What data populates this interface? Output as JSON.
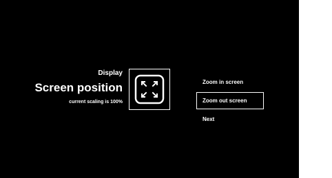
{
  "screen": {
    "section_label": "Display",
    "title": "Screen position",
    "subtitle": "current scaling is 100%",
    "icon": "fullscreen-icon"
  },
  "menu": {
    "items": [
      {
        "label": "Zoom in screen",
        "selected": false
      },
      {
        "label": "Zoom out screen",
        "selected": true
      },
      {
        "label": "Next",
        "selected": false
      }
    ]
  },
  "colors": {
    "background": "#000000",
    "foreground": "#ffffff"
  }
}
